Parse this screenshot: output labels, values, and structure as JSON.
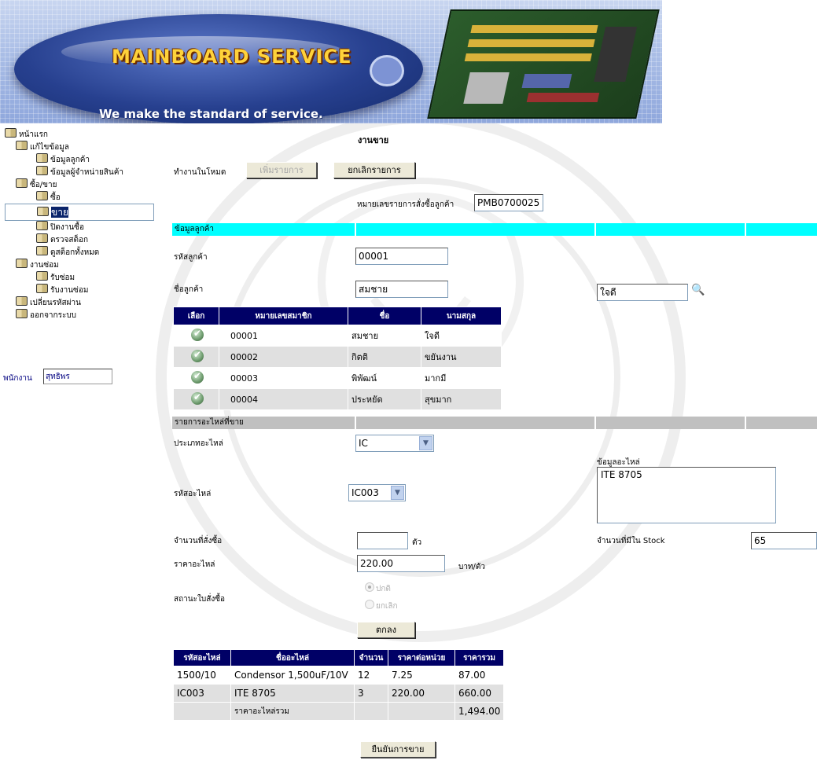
{
  "banner": {
    "brand": "MAINBOARD SERVICE",
    "tagline": "We make the standard of service."
  },
  "nav": [
    {
      "label": "หน้าแรก",
      "level": 1
    },
    {
      "label": "แก้ไขข้อมูล",
      "level": 2
    },
    {
      "label": "ข้อมูลลูกค้า",
      "level": 3
    },
    {
      "label": "ข้อมูลผู้จำหน่ายสินค้า",
      "level": 3
    },
    {
      "label": "ซื้อ/ขาย",
      "level": 2
    },
    {
      "label": "ซื้อ",
      "level": 3
    },
    {
      "label": "ขาย",
      "level": 3,
      "selected": true
    },
    {
      "label": "ปิดงานซื้อ",
      "level": 3
    },
    {
      "label": "ตรวจสต็อก",
      "level": 3
    },
    {
      "label": "ดูสต็อกทั้งหมด",
      "level": 3
    },
    {
      "label": "งานซ่อม",
      "level": 2
    },
    {
      "label": "รับซ่อม",
      "level": 3
    },
    {
      "label": "รับงานซ่อม",
      "level": 3
    },
    {
      "label": "เปลี่ยนรหัสผ่าน",
      "level": 2
    },
    {
      "label": "ออกจากระบบ",
      "level": 2
    }
  ],
  "staff": {
    "label": "พนักงาน",
    "value": "สุทธิพร"
  },
  "page": {
    "title": "งานขาย",
    "mode_label": "ทำงานในโหมด",
    "add_button": "เพิ่มรายการ",
    "cancel_button": "ยกเลิกรายการ",
    "order_no_label": "หมายเลขรายการสั่งซื้อลูกค้า",
    "order_no": "PMB0700025"
  },
  "customer": {
    "section": "ข้อมูลลูกค้า",
    "id_label": "รหัสลูกค้า",
    "id_value": "00001",
    "name_label": "ชื่อลูกค้า",
    "first_name": "สมชาย",
    "last_name": "ใจดี",
    "headers": [
      "เลือก",
      "หมายเลขสมาชิก",
      "ชื่อ",
      "นามสกุล"
    ],
    "rows": [
      {
        "member": "00001",
        "first": "สมชาย",
        "last": "ใจดี"
      },
      {
        "member": "00002",
        "first": "กิตติ",
        "last": "ขยันงาน"
      },
      {
        "member": "00003",
        "first": "พิพัฒน์",
        "last": "มากมี"
      },
      {
        "member": "00004",
        "first": "ประหยัด",
        "last": "สุขมาก"
      }
    ]
  },
  "parts": {
    "section": "รายการอะไหล่ที่ขาย",
    "type_label": "ประเภทอะไหล่",
    "type_value": "IC",
    "code_label": "รหัสอะไหล่",
    "code_value": "IC003",
    "info_label": "ข้อมูลอะไหล่",
    "info_value": "ITE 8705",
    "qty_label": "จำนวนที่สั่งซื้อ",
    "qty_value": "",
    "qty_unit": "ตัว",
    "stock_label": "จำนวนที่มีใน Stock",
    "stock_value": "65",
    "price_label": "ราคาอะไหล่",
    "price_value": "220.00",
    "price_unit": "บาท/ตัว",
    "status_label": "สถานะใบสั่งซื้อ",
    "status_normal": "ปกติ",
    "status_cancel": "ยกเลิก",
    "ok_button": "ตกลง"
  },
  "items": {
    "headers": [
      "รหัสอะไหล่",
      "ชื่ออะไหล่",
      "จำนวน",
      "ราคาต่อหน่วย",
      "ราคารวม"
    ],
    "rows": [
      {
        "code": "1500/10",
        "name": "Condensor 1,500uF/10V",
        "qty": "12",
        "unit": "7.25",
        "total": "87.00"
      },
      {
        "code": "IC003",
        "name": "ITE 8705",
        "qty": "3",
        "unit": "220.00",
        "total": "660.00"
      }
    ],
    "sum_label": "ราคาอะไหล่รวม",
    "sum_value": "1,494.00"
  },
  "confirm_button": "ยืนยันการขาย",
  "colors": {
    "header_bg": "#000066",
    "section_customer": "#00ffff",
    "section_parts": "#c0c0c0"
  }
}
